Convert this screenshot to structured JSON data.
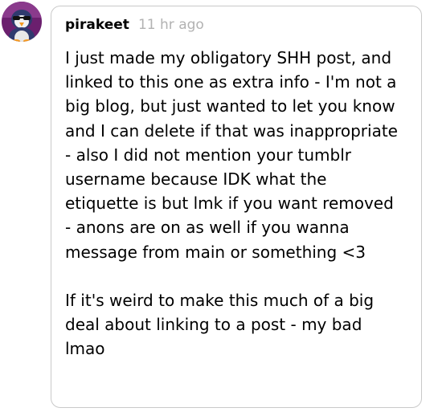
{
  "reply": {
    "username": "pirakeet",
    "timestamp": "11 hr ago",
    "avatar_icon": "penguin-sunglasses-avatar",
    "paragraph1_lines": [
      "I just made my obligatory SHH post, and",
      "linked to this one as extra info - I'm not a",
      "big blog, but just wanted to let you know",
      "and I can delete if that was inappropriate",
      "- also I did not mention your tumblr",
      "username because IDK what the",
      "etiquette is but lmk if you want removed",
      "- anons are on as well if you wanna",
      "message from main or something <3"
    ],
    "paragraph2_lines": [
      "If it's weird to make this much of a big",
      "deal about linking to a post - my bad",
      "lmao"
    ]
  },
  "colors": {
    "border": "#c9c9c9",
    "timestamp": "#b2b2b2",
    "text": "#000000",
    "avatar_purple": "#6b1f6e",
    "avatar_orange": "#f59a23"
  }
}
